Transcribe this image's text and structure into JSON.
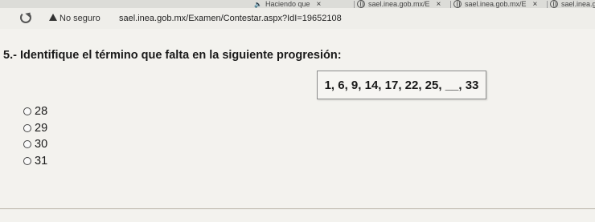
{
  "browser": {
    "tabs": [
      {
        "title": "Haciendo que",
        "close": "×"
      },
      {
        "title": "sael.inea.gob.mx/E",
        "close": "×"
      },
      {
        "title": "sael.inea.gob.mx/E",
        "close": "×"
      },
      {
        "title": "sael.inea.g",
        "close": ""
      }
    ],
    "security_label": "No seguro",
    "url": "sael.inea.gob.mx/Examen/Contestar.aspx?IdI=19652108"
  },
  "question": {
    "number": "5.-",
    "text": "Identifique el término que falta en la siguiente progresión:",
    "sequence": "1, 6, 9, 14, 17, 22, 25, __, 33"
  },
  "options": [
    {
      "label": "28"
    },
    {
      "label": "29"
    },
    {
      "label": "30"
    },
    {
      "label": "31"
    }
  ]
}
